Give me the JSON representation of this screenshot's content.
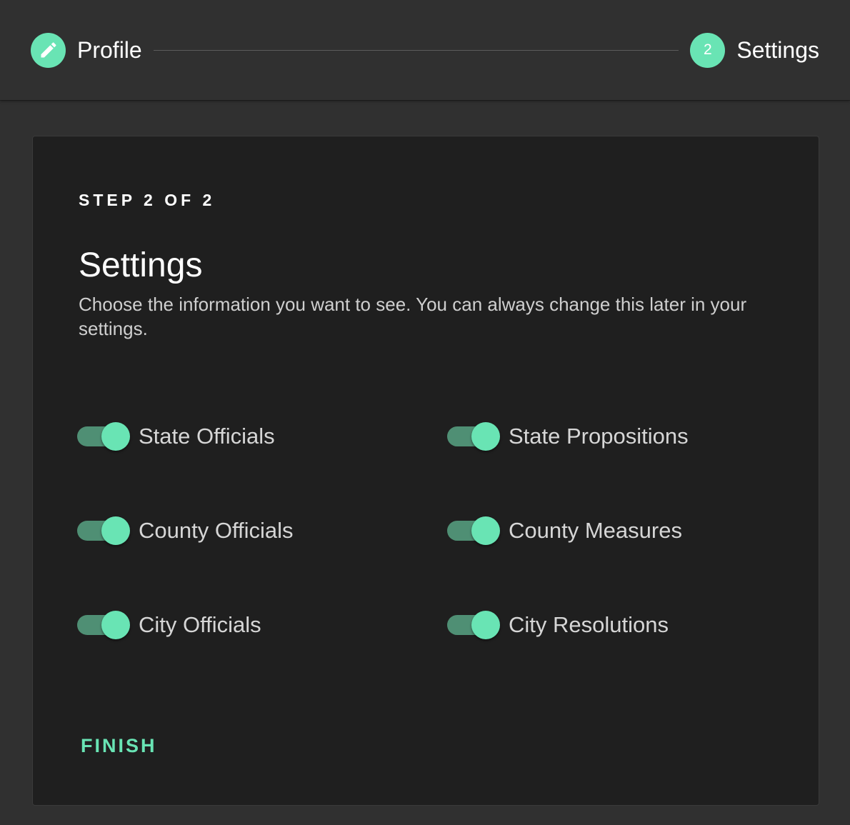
{
  "stepper": {
    "steps": [
      {
        "label": "Profile",
        "icon": "pencil-icon",
        "state": "completed"
      },
      {
        "label": "Settings",
        "number": "2",
        "state": "active"
      }
    ]
  },
  "card": {
    "step_count": "STEP 2 OF 2",
    "title": "Settings",
    "description": "Choose the information you want to see. You can always change this later in your settings.",
    "toggles": [
      {
        "label": "State Officials",
        "checked": true
      },
      {
        "label": "State Propositions",
        "checked": true
      },
      {
        "label": "County Officials",
        "checked": true
      },
      {
        "label": "County Measures",
        "checked": true
      },
      {
        "label": "City Officials",
        "checked": true
      },
      {
        "label": "City Resolutions",
        "checked": true
      }
    ],
    "finish_label": "FINISH"
  },
  "colors": {
    "accent": "#69e4b4",
    "track": "#4f8f74",
    "page_bg": "#303030",
    "card_bg": "#1f1f1f"
  }
}
